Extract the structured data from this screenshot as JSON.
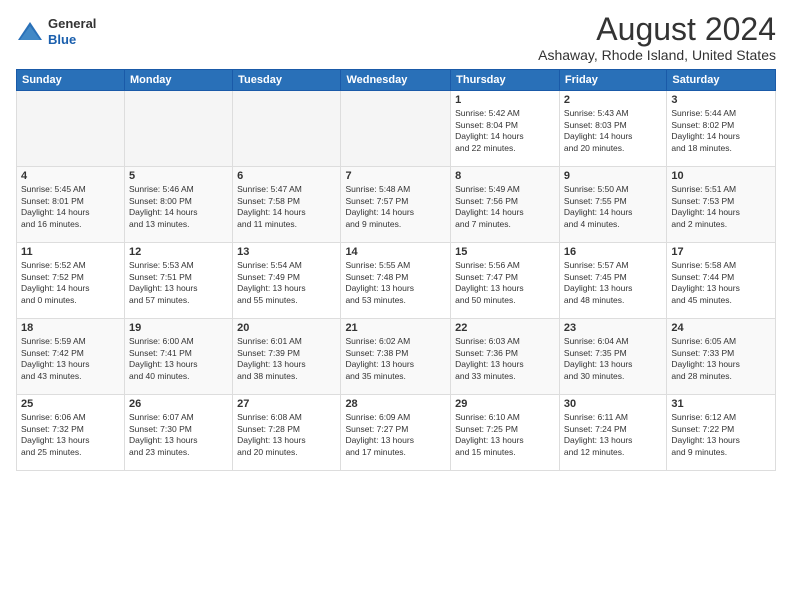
{
  "logo": {
    "general": "General",
    "blue": "Blue"
  },
  "title": "August 2024",
  "subtitle": "Ashaway, Rhode Island, United States",
  "headers": [
    "Sunday",
    "Monday",
    "Tuesday",
    "Wednesday",
    "Thursday",
    "Friday",
    "Saturday"
  ],
  "weeks": [
    [
      {
        "day": "",
        "info": ""
      },
      {
        "day": "",
        "info": ""
      },
      {
        "day": "",
        "info": ""
      },
      {
        "day": "",
        "info": ""
      },
      {
        "day": "1",
        "info": "Sunrise: 5:42 AM\nSunset: 8:04 PM\nDaylight: 14 hours\nand 22 minutes."
      },
      {
        "day": "2",
        "info": "Sunrise: 5:43 AM\nSunset: 8:03 PM\nDaylight: 14 hours\nand 20 minutes."
      },
      {
        "day": "3",
        "info": "Sunrise: 5:44 AM\nSunset: 8:02 PM\nDaylight: 14 hours\nand 18 minutes."
      }
    ],
    [
      {
        "day": "4",
        "info": "Sunrise: 5:45 AM\nSunset: 8:01 PM\nDaylight: 14 hours\nand 16 minutes."
      },
      {
        "day": "5",
        "info": "Sunrise: 5:46 AM\nSunset: 8:00 PM\nDaylight: 14 hours\nand 13 minutes."
      },
      {
        "day": "6",
        "info": "Sunrise: 5:47 AM\nSunset: 7:58 PM\nDaylight: 14 hours\nand 11 minutes."
      },
      {
        "day": "7",
        "info": "Sunrise: 5:48 AM\nSunset: 7:57 PM\nDaylight: 14 hours\nand 9 minutes."
      },
      {
        "day": "8",
        "info": "Sunrise: 5:49 AM\nSunset: 7:56 PM\nDaylight: 14 hours\nand 7 minutes."
      },
      {
        "day": "9",
        "info": "Sunrise: 5:50 AM\nSunset: 7:55 PM\nDaylight: 14 hours\nand 4 minutes."
      },
      {
        "day": "10",
        "info": "Sunrise: 5:51 AM\nSunset: 7:53 PM\nDaylight: 14 hours\nand 2 minutes."
      }
    ],
    [
      {
        "day": "11",
        "info": "Sunrise: 5:52 AM\nSunset: 7:52 PM\nDaylight: 14 hours\nand 0 minutes."
      },
      {
        "day": "12",
        "info": "Sunrise: 5:53 AM\nSunset: 7:51 PM\nDaylight: 13 hours\nand 57 minutes."
      },
      {
        "day": "13",
        "info": "Sunrise: 5:54 AM\nSunset: 7:49 PM\nDaylight: 13 hours\nand 55 minutes."
      },
      {
        "day": "14",
        "info": "Sunrise: 5:55 AM\nSunset: 7:48 PM\nDaylight: 13 hours\nand 53 minutes."
      },
      {
        "day": "15",
        "info": "Sunrise: 5:56 AM\nSunset: 7:47 PM\nDaylight: 13 hours\nand 50 minutes."
      },
      {
        "day": "16",
        "info": "Sunrise: 5:57 AM\nSunset: 7:45 PM\nDaylight: 13 hours\nand 48 minutes."
      },
      {
        "day": "17",
        "info": "Sunrise: 5:58 AM\nSunset: 7:44 PM\nDaylight: 13 hours\nand 45 minutes."
      }
    ],
    [
      {
        "day": "18",
        "info": "Sunrise: 5:59 AM\nSunset: 7:42 PM\nDaylight: 13 hours\nand 43 minutes."
      },
      {
        "day": "19",
        "info": "Sunrise: 6:00 AM\nSunset: 7:41 PM\nDaylight: 13 hours\nand 40 minutes."
      },
      {
        "day": "20",
        "info": "Sunrise: 6:01 AM\nSunset: 7:39 PM\nDaylight: 13 hours\nand 38 minutes."
      },
      {
        "day": "21",
        "info": "Sunrise: 6:02 AM\nSunset: 7:38 PM\nDaylight: 13 hours\nand 35 minutes."
      },
      {
        "day": "22",
        "info": "Sunrise: 6:03 AM\nSunset: 7:36 PM\nDaylight: 13 hours\nand 33 minutes."
      },
      {
        "day": "23",
        "info": "Sunrise: 6:04 AM\nSunset: 7:35 PM\nDaylight: 13 hours\nand 30 minutes."
      },
      {
        "day": "24",
        "info": "Sunrise: 6:05 AM\nSunset: 7:33 PM\nDaylight: 13 hours\nand 28 minutes."
      }
    ],
    [
      {
        "day": "25",
        "info": "Sunrise: 6:06 AM\nSunset: 7:32 PM\nDaylight: 13 hours\nand 25 minutes."
      },
      {
        "day": "26",
        "info": "Sunrise: 6:07 AM\nSunset: 7:30 PM\nDaylight: 13 hours\nand 23 minutes."
      },
      {
        "day": "27",
        "info": "Sunrise: 6:08 AM\nSunset: 7:28 PM\nDaylight: 13 hours\nand 20 minutes."
      },
      {
        "day": "28",
        "info": "Sunrise: 6:09 AM\nSunset: 7:27 PM\nDaylight: 13 hours\nand 17 minutes."
      },
      {
        "day": "29",
        "info": "Sunrise: 6:10 AM\nSunset: 7:25 PM\nDaylight: 13 hours\nand 15 minutes."
      },
      {
        "day": "30",
        "info": "Sunrise: 6:11 AM\nSunset: 7:24 PM\nDaylight: 13 hours\nand 12 minutes."
      },
      {
        "day": "31",
        "info": "Sunrise: 6:12 AM\nSunset: 7:22 PM\nDaylight: 13 hours\nand 9 minutes."
      }
    ]
  ]
}
